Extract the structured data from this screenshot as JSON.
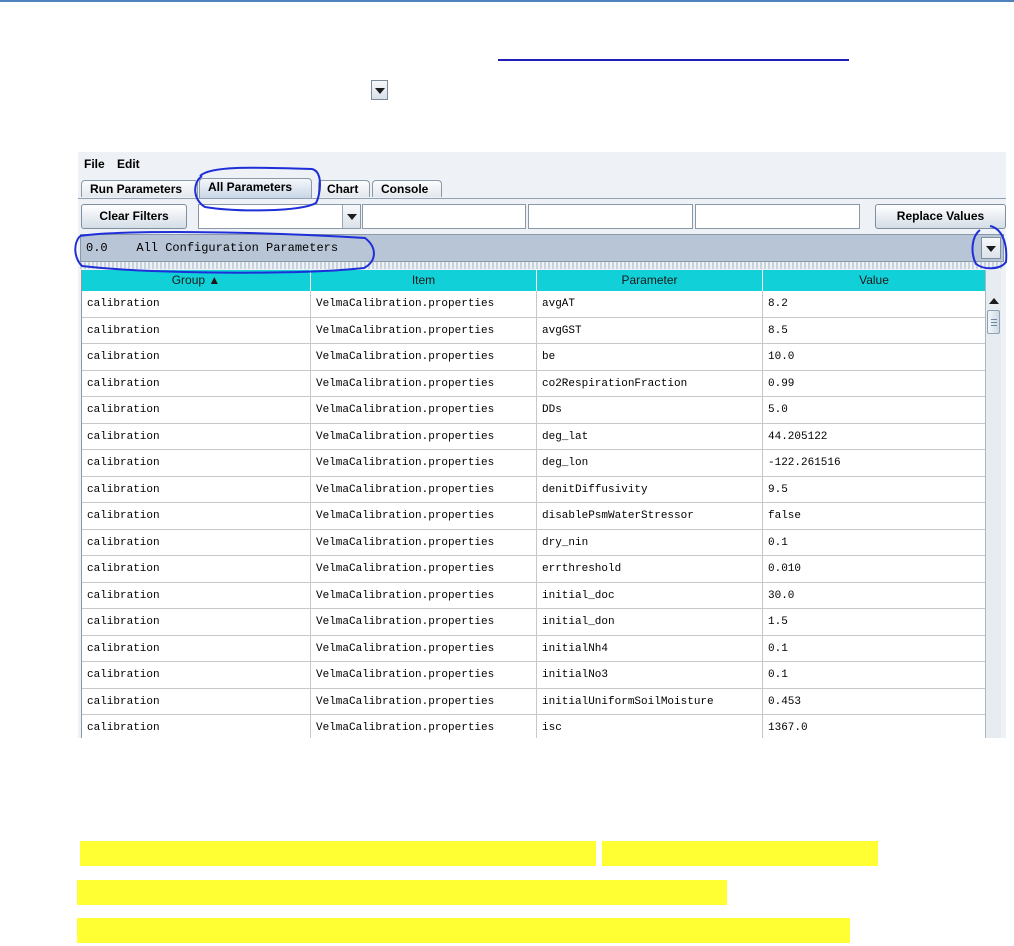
{
  "menu": {
    "file": "File",
    "edit": "Edit"
  },
  "tabs": [
    {
      "label": "Run Parameters",
      "active": false
    },
    {
      "label": "All Parameters",
      "active": true
    },
    {
      "label": "Chart",
      "active": false
    },
    {
      "label": "Console",
      "active": false
    }
  ],
  "filters": {
    "clear_label": "Clear Filters",
    "replace_label": "Replace Values"
  },
  "selector": {
    "text": "0.0    All Configuration Parameters"
  },
  "table": {
    "columns": [
      "Group ▲",
      "Item",
      "Parameter",
      "Value"
    ],
    "rows": [
      [
        "calibration",
        "VelmaCalibration.properties",
        "avgAT",
        "8.2"
      ],
      [
        "calibration",
        "VelmaCalibration.properties",
        "avgGST",
        "8.5"
      ],
      [
        "calibration",
        "VelmaCalibration.properties",
        "be",
        "10.0"
      ],
      [
        "calibration",
        "VelmaCalibration.properties",
        "co2RespirationFraction",
        "0.99"
      ],
      [
        "calibration",
        "VelmaCalibration.properties",
        "DDs",
        "5.0"
      ],
      [
        "calibration",
        "VelmaCalibration.properties",
        "deg_lat",
        "44.205122"
      ],
      [
        "calibration",
        "VelmaCalibration.properties",
        "deg_lon",
        "-122.261516"
      ],
      [
        "calibration",
        "VelmaCalibration.properties",
        "denitDiffusivity",
        "9.5"
      ],
      [
        "calibration",
        "VelmaCalibration.properties",
        "disablePsmWaterStressor",
        "false"
      ],
      [
        "calibration",
        "VelmaCalibration.properties",
        "dry_nin",
        "0.1"
      ],
      [
        "calibration",
        "VelmaCalibration.properties",
        "errthreshold",
        "0.010"
      ],
      [
        "calibration",
        "VelmaCalibration.properties",
        "initial_doc",
        "30.0"
      ],
      [
        "calibration",
        "VelmaCalibration.properties",
        "initial_don",
        "1.5"
      ],
      [
        "calibration",
        "VelmaCalibration.properties",
        "initialNh4",
        "0.1"
      ],
      [
        "calibration",
        "VelmaCalibration.properties",
        "initialNo3",
        "0.1"
      ],
      [
        "calibration",
        "VelmaCalibration.properties",
        "initialUniformSoilMoisture",
        "0.453"
      ],
      [
        "calibration",
        "VelmaCalibration.properties",
        "isc",
        "1367.0"
      ]
    ]
  },
  "colors": {
    "header": "#12d0d8",
    "annotation": "#1f2fd8",
    "highlight": "#ffff33"
  }
}
